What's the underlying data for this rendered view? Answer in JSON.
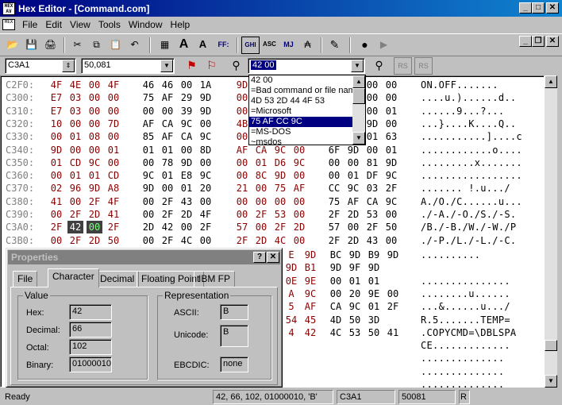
{
  "window": {
    "title": "Hex Editor - [Command.com]",
    "app_icon_text": "HEX AV"
  },
  "menu": [
    "File",
    "Edit",
    "View",
    "Tools",
    "Window",
    "Help"
  ],
  "toolbar": {
    "font_big": "A",
    "font_small": "A",
    "ff_label": "FF:",
    "ghi_label": "GHI",
    "asc_label": "ASC",
    "mj_label": "MJ"
  },
  "bar2": {
    "address": "C3A1",
    "offset": "50,081",
    "search_value": "42 00"
  },
  "dropdown": {
    "options": [
      "42 00",
      "=Bad command or file name",
      "4D 53 2D 44 4F 53",
      "=Microsoft",
      "75 AF CC 9C",
      "=MS-DOS",
      "~msdos"
    ],
    "selected_index": 4
  },
  "hex_rows": [
    {
      "addr": "C2F0:",
      "bytes": [
        "4F",
        "4E",
        "00",
        "4F",
        "46",
        "46",
        "00",
        "1A",
        "9D",
        "",
        "",
        "",
        "",
        "",
        "00",
        "00"
      ],
      "ascii": "ON.OFF......."
    },
    {
      "addr": "C300:",
      "bytes": [
        "E7",
        "03",
        "00",
        "00",
        "75",
        "AF",
        "29",
        "9D",
        "00",
        "",
        "",
        "",
        "",
        "",
        "00",
        "00"
      ],
      "ascii": "....u.)......d.."
    },
    {
      "addr": "C310:",
      "bytes": [
        "E7",
        "03",
        "00",
        "00",
        "00",
        "00",
        "39",
        "9D",
        "00",
        "",
        "",
        "",
        "",
        "",
        "00",
        "01"
      ],
      "ascii": "......9...?..."
    },
    {
      "addr": "C320:",
      "bytes": [
        "10",
        "00",
        "00",
        "7D",
        "AF",
        "CA",
        "9C",
        "00",
        "4B",
        "",
        "",
        "",
        "",
        "",
        "9D",
        "00"
      ],
      "ascii": "...}....K....Q.."
    },
    {
      "addr": "C330:",
      "bytes": [
        "00",
        "01",
        "08",
        "00",
        "85",
        "AF",
        "CA",
        "9C",
        "00",
        "",
        "",
        "",
        "",
        "",
        "01",
        "63"
      ],
      "ascii": "...........]....c"
    },
    {
      "addr": "C340:",
      "bytes": [
        "9D",
        "00",
        "00",
        "01",
        "01",
        "01",
        "00",
        "8D",
        "AF",
        "CA",
        "9C",
        "00",
        "6F",
        "9D",
        "00",
        "01"
      ],
      "ascii": "............o...."
    },
    {
      "addr": "C350:",
      "bytes": [
        "01",
        "CD",
        "9C",
        "00",
        "00",
        "78",
        "9D",
        "00",
        "00",
        "01",
        "D6",
        "9C",
        "00",
        "00",
        "81",
        "9D"
      ],
      "ascii": ".........x......."
    },
    {
      "addr": "C360:",
      "bytes": [
        "00",
        "01",
        "01",
        "CD",
        "9C",
        "01",
        "E8",
        "9C",
        "00",
        "8C",
        "9D",
        "00",
        "00",
        "01",
        "DF",
        "9C"
      ],
      "ascii": "................."
    },
    {
      "addr": "C370:",
      "bytes": [
        "02",
        "96",
        "9D",
        "A8",
        "9D",
        "00",
        "01",
        "20",
        "21",
        "00",
        "75",
        "AF",
        "CC",
        "9C",
        "03",
        "2F"
      ],
      "ascii": "....... !.u.../"
    },
    {
      "addr": "C380:",
      "bytes": [
        "41",
        "00",
        "2F",
        "4F",
        "00",
        "2F",
        "43",
        "00",
        "00",
        "00",
        "00",
        "00",
        "75",
        "AF",
        "CA",
        "9C"
      ],
      "ascii": "A./O./C......u..."
    },
    {
      "addr": "C390:",
      "bytes": [
        "00",
        "2F",
        "2D",
        "41",
        "00",
        "2F",
        "2D",
        "4F",
        "00",
        "2F",
        "53",
        "00",
        "2F",
        "2D",
        "53",
        "00"
      ],
      "ascii": "./-A./-O./S./-S."
    },
    {
      "addr": "C3A0:",
      "bytes": [
        "2F",
        "42",
        "00",
        "2F",
        "2D",
        "42",
        "00",
        "2F",
        "57",
        "00",
        "2F",
        "2D",
        "57",
        "00",
        "2F",
        "50"
      ],
      "ascii": "/B./-B./W./-W./P"
    },
    {
      "addr": "C3B0:",
      "bytes": [
        "00",
        "2F",
        "2D",
        "50",
        "00",
        "2F",
        "4C",
        "00",
        "2F",
        "2D",
        "4C",
        "00",
        "2F",
        "2D",
        "43",
        "00"
      ],
      "ascii": "./-P./L./-L./-C."
    },
    {
      "addr": "",
      "bytes": [
        "",
        "",
        "",
        "",
        "",
        "",
        "",
        "",
        "",
        "",
        "",
        "",
        "9D",
        "BC",
        "9D",
        "B9",
        "9D"
      ],
      "ascii": ""
    },
    {
      "addr": "",
      "bytes": [],
      "ascii": ""
    }
  ],
  "lower_right": [
    {
      "bytes": [
        "E",
        "9D",
        "BC",
        "9D",
        "B9",
        "9D"
      ],
      "ascii": ".........."
    },
    {
      "bytes": [
        "9D",
        "B1",
        "9D",
        "9F",
        "9D"
      ],
      "ascii": ""
    },
    {
      "bytes": [
        "0E",
        "9E",
        "00",
        "01",
        "01"
      ],
      "ascii": "..............."
    },
    {
      "bytes": [
        "A",
        "9C",
        "00",
        "20",
        "9E",
        "00"
      ],
      "ascii": "........u......"
    },
    {
      "bytes": [
        "5",
        "AF",
        "CA",
        "9C",
        "01",
        "2F"
      ],
      "ascii": "...&......u.../"
    },
    {
      "bytes": [
        "54",
        "45",
        "4D",
        "50",
        "3D"
      ],
      "ascii": "R.5.......TEMP="
    },
    {
      "bytes": [
        "4",
        "42",
        "4C",
        "53",
        "50",
        "41"
      ],
      "ascii": ".COPYCMD=\\DBLSPA"
    },
    {
      "bytes": [
        "",
        "",
        "",
        "",
        ""
      ],
      "ascii": "CE............."
    },
    {
      "bytes": [
        "",
        "",
        "",
        "",
        ""
      ],
      "ascii": ".............."
    },
    {
      "bytes": [
        "",
        "",
        "",
        "",
        ""
      ],
      "ascii": ".............."
    },
    {
      "bytes": [
        "",
        "",
        "",
        "",
        ""
      ],
      "ascii": ".............."
    }
  ],
  "properties": {
    "title": "Properties",
    "tabs": [
      "File",
      "Character",
      "Decimal",
      "Floating Point",
      "IBM FP"
    ],
    "active_tab": "Character",
    "value_group": "Value",
    "representation_group": "Representation",
    "hex_label": "Hex:",
    "hex": "42",
    "decimal_label": "Decimal:",
    "decimal": "66",
    "octal_label": "Octal:",
    "octal": "102",
    "binary_label": "Binary:",
    "binary": "01000010",
    "ascii_label": "ASCII:",
    "ascii": "B",
    "unicode_label": "Unicode:",
    "unicode": "B",
    "ebcdic_label": "EBCDIC:",
    "ebcdic": "none"
  },
  "status": {
    "ready": "Ready",
    "value": "42, 66, 102, 01000010, 'B'",
    "address": "C3A1",
    "offset": "50081",
    "mode": "R"
  }
}
